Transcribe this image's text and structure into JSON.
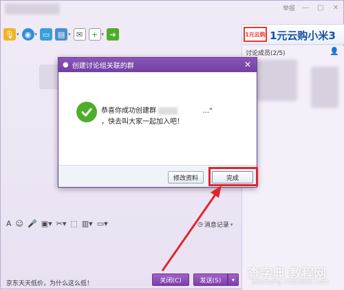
{
  "window": {
    "report_label": "举报",
    "controls": [
      "—",
      "□",
      "✕"
    ]
  },
  "ad": {
    "logo_text": "1元云购",
    "headline": "1元云购小米3"
  },
  "members": {
    "label": "讨论成员(2/5)"
  },
  "toolbar": {
    "icons": [
      "microphone-icon",
      "video-icon",
      "screen-share-icon",
      "folder-icon",
      "email-icon",
      "app-icon",
      "exit-icon"
    ]
  },
  "edit_toolbar": {
    "history_label": "消息记录"
  },
  "dialog": {
    "title": "创建讨论组关联的群",
    "message_line1": "恭喜你成功创建群",
    "message_suffix": "...\"",
    "message_line2": "，快去叫大家一起加入吧！",
    "edit_button": "修改资料",
    "done_button": "完成"
  },
  "bottom": {
    "ad_text": "京东天天低价，为什么这么低！",
    "close_button": "关闭(C)",
    "send_button": "发送(S)"
  },
  "watermark": {
    "line1": "查字典 教程网",
    "line2": "jiaocheng.chazidian.com"
  },
  "colors": {
    "accent_purple": "#7c3eaa",
    "highlight_red": "#e0242c",
    "success_green": "#4caf2a",
    "ad_blue": "#1a4fa0"
  }
}
